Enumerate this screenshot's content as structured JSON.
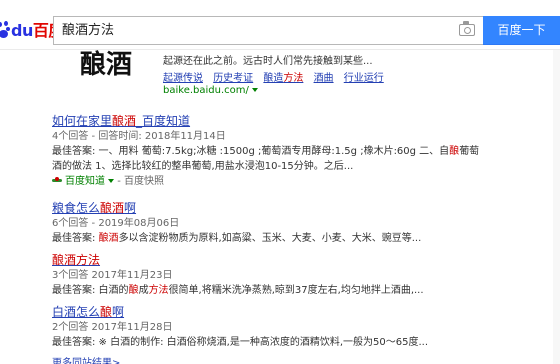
{
  "header": {
    "logo_du": "du",
    "logo_text": "百度",
    "search_value": "酿酒方法",
    "search_button": "百度一下",
    "camera_icon": "camera-icon"
  },
  "baike": {
    "image_text": "酿酒",
    "summary": "起源还在此之前。远古时人们常先接触到某些...",
    "links": [
      {
        "pre": "起源传说",
        "hl": "",
        "post": ""
      },
      {
        "pre": "历史考证",
        "hl": "",
        "post": ""
      },
      {
        "pre": "酿造",
        "hl": "方法",
        "post": ""
      },
      {
        "pre": "酒曲",
        "hl": "",
        "post": ""
      },
      {
        "pre": "行业运行",
        "hl": "",
        "post": ""
      }
    ],
    "url": "baike.baidu.com/"
  },
  "results": [
    {
      "title_pre": "如何在家里",
      "title_hl": "酿酒",
      "title_post": "_百度知道",
      "meta": "4个回答 - 回答时间: 2018年11月14日",
      "body_1": "最佳答案: 一、用料 葡萄:7.5kg;冰糖 :1500g ;葡萄酒专用酵母:1.5g ;橡木片:60g 二、自",
      "body_1_hl": "酿",
      "body_1_post": "葡萄",
      "body_2": "酒的做法 1、选择比较红的整串葡萄,用盐水浸泡10-15分钟。之后...",
      "source": "百度知道",
      "snapshot": "- 百度快照"
    },
    {
      "title_pre": "粮食怎么",
      "title_hl": "酿酒",
      "title_post": "啊",
      "meta": "6个回答 - 2019年08月06日",
      "body_pre": "最佳答案: ",
      "body_hl": "酿酒",
      "body_post": "多以含淀粉物质为原料,如高粱、玉米、大麦、小麦、大米、豌豆等..."
    },
    {
      "title_pre": "",
      "title_hl": "酿酒方法",
      "title_post": "",
      "meta": "3个回答 2017年11月23日",
      "body_pre": "最佳答案: 白酒的",
      "body_hl": "酿",
      "body_mid": "成",
      "body_hl2": "方法",
      "body_post": "很简单,将糯米洗净蒸熟,晾到37度左右,均匀地拌上酒曲,..."
    },
    {
      "title_pre": "白酒怎么",
      "title_hl": "酿",
      "title_post": "啊",
      "meta": "2个回答 2017年11月28日",
      "body_pre": "最佳答案: ※ 白酒的制作: 白酒俗称烧酒,是一种高浓度的酒精饮料,一般为50～65度..."
    }
  ],
  "more_link": "更多同站结果>"
}
